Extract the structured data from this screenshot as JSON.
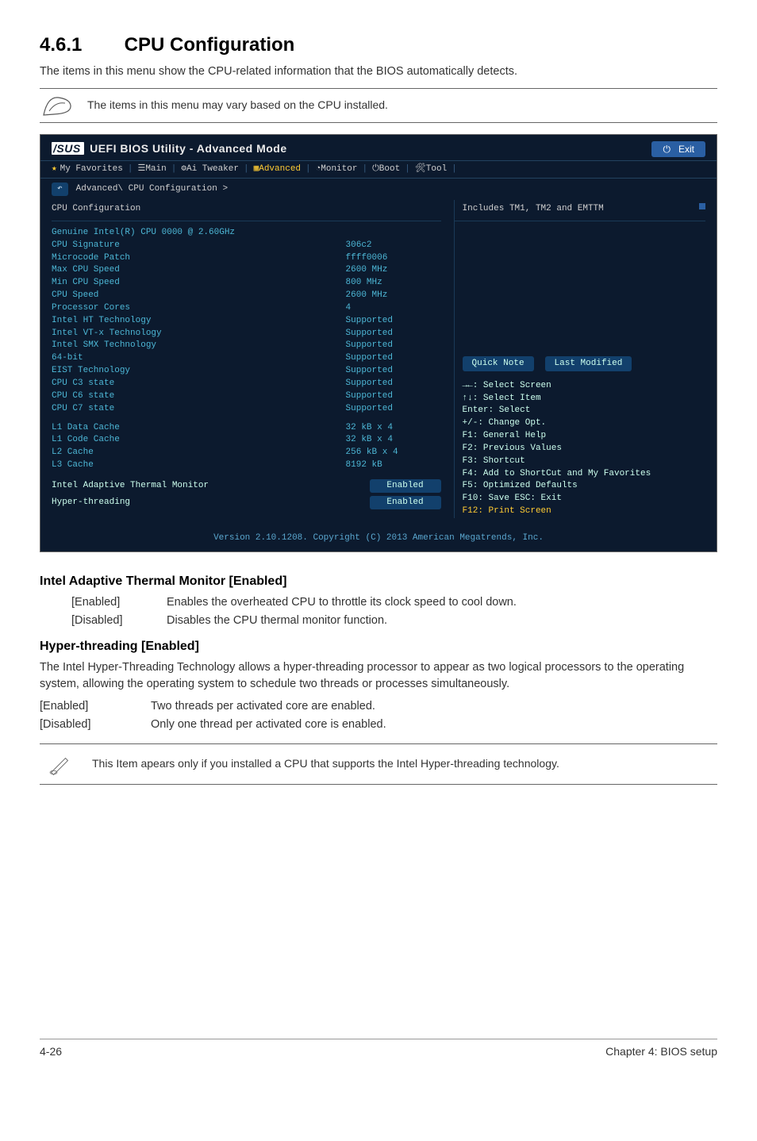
{
  "section": {
    "number": "4.6.1",
    "title": "CPU Configuration"
  },
  "intro": "The items in this menu show the CPU-related information that the BIOS automatically detects.",
  "note1": "The items in this menu may vary based on the CPU installed.",
  "bios": {
    "logo_prefix": "/SUS",
    "logo_text": "UEFI BIOS Utility - Advanced Mode",
    "exit": "Exit",
    "tabs": {
      "fav": "My Favorites",
      "main": "Main",
      "ai": "Ai Tweaker",
      "adv": "Advanced",
      "mon": "Monitor",
      "boot": "Boot",
      "tool": "Tool"
    },
    "crumb": "Advanced\\ CPU Configuration >",
    "heading": "CPU Configuration",
    "help": "Includes TM1, TM2 and EMTTM",
    "rows": [
      {
        "k": "Genuine Intel(R) CPU 0000 @ 2.60GHz",
        "v": ""
      },
      {
        "k": "CPU Signature",
        "v": "306c2"
      },
      {
        "k": "Microcode Patch",
        "v": "ffff0006"
      },
      {
        "k": "Max CPU Speed",
        "v": "2600 MHz"
      },
      {
        "k": "Min CPU Speed",
        "v": "800 MHz"
      },
      {
        "k": "CPU Speed",
        "v": "2600 MHz"
      },
      {
        "k": "Processor Cores",
        "v": "4"
      },
      {
        "k": "Intel HT Technology",
        "v": "Supported"
      },
      {
        "k": "Intel VT-x Technology",
        "v": "Supported"
      },
      {
        "k": "Intel SMX Technology",
        "v": "Supported"
      },
      {
        "k": "64-bit",
        "v": "Supported"
      },
      {
        "k": "EIST Technology",
        "v": "Supported"
      },
      {
        "k": "CPU C3 state",
        "v": "Supported"
      },
      {
        "k": "CPU C6 state",
        "v": "Supported"
      },
      {
        "k": "CPU C7 state",
        "v": "Supported"
      }
    ],
    "cache": [
      {
        "k": "L1 Data Cache",
        "v": "32 kB x 4"
      },
      {
        "k": "L1 Code Cache",
        "v": "32 kB x 4"
      },
      {
        "k": "L2 Cache",
        "v": "256 kB x 4"
      },
      {
        "k": "L3 Cache",
        "v": "8192 kB"
      }
    ],
    "opts": [
      {
        "label": "Intel Adaptive Thermal Monitor",
        "value": "Enabled"
      },
      {
        "label": "Hyper-threading",
        "value": "Enabled"
      }
    ],
    "quick_note": "Quick Note",
    "last_mod": "Last Modified",
    "hints": {
      "a": "→←: Select Screen",
      "b": "↑↓: Select Item",
      "c": "Enter: Select",
      "d": "+/-: Change Opt.",
      "e": "F1: General Help",
      "f": "F2: Previous Values",
      "g": "F3: Shortcut",
      "h": "F4: Add to ShortCut and My Favorites",
      "i": "F5: Optimized Defaults",
      "j": "F10: Save  ESC: Exit",
      "k": "F12: Print Screen"
    },
    "version": "Version 2.10.1208. Copyright (C) 2013 American Megatrends, Inc."
  },
  "s1": {
    "title": "Intel Adaptive Thermal Monitor [Enabled]",
    "rows": [
      {
        "term": "[Enabled]",
        "desc": "Enables the overheated CPU to throttle its clock speed to cool down."
      },
      {
        "term": "[Disabled]",
        "desc": "Disables the CPU thermal monitor function."
      }
    ]
  },
  "s2": {
    "title": "Hyper-threading [Enabled]",
    "body": "The Intel Hyper-Threading Technology allows a hyper-threading processor to appear as two logical processors to the operating system, allowing the operating system to schedule two threads or processes simultaneously.",
    "rows": [
      {
        "term": "[Enabled]",
        "desc": "Two threads per activated core are enabled."
      },
      {
        "term": "[Disabled]",
        "desc": "Only one thread per activated core is enabled."
      }
    ]
  },
  "note2": "This Item apears only if you installed a CPU that supports the Intel Hyper-threading technology.",
  "footer": {
    "left": "4-26",
    "right": "Chapter 4: BIOS setup"
  }
}
